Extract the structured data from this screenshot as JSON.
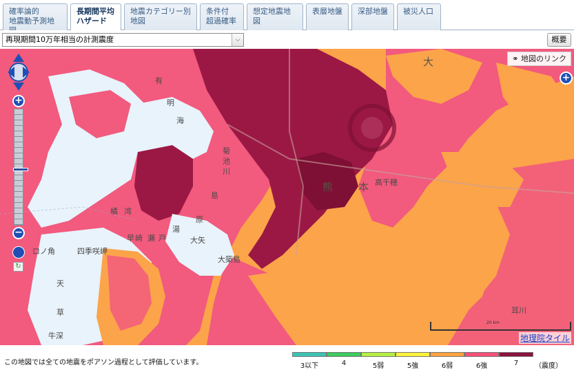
{
  "tabs": [
    {
      "line1": "確率論的",
      "line2": "地震動予測地図",
      "active": false
    },
    {
      "line1": "長期間平均",
      "line2": "ハザード",
      "active": true
    },
    {
      "line1": "地震カテゴリー別",
      "line2": "地図",
      "active": false
    },
    {
      "line1": "条件付",
      "line2": "超過確率",
      "active": false
    },
    {
      "line1": "想定地震地図",
      "line2": "",
      "active": false
    },
    {
      "line1": "表層地盤",
      "line2": "",
      "active": false
    },
    {
      "line1": "深部地盤",
      "line2": "",
      "active": false
    },
    {
      "line1": "被災人口",
      "line2": "",
      "active": false
    }
  ],
  "selector": {
    "value": "再現期間10万年相当の計測震度",
    "arrow": "⌵"
  },
  "overview_button": "概要",
  "map": {
    "link_button": "地図のリンク",
    "tile_credit": "地理院タイル",
    "scale_label": "20 km",
    "labels": [
      {
        "text": "有",
        "big": false
      },
      {
        "text": "明",
        "big": false
      },
      {
        "text": "海",
        "big": false
      },
      {
        "text": "菊",
        "big": false
      },
      {
        "text": "池",
        "big": false
      },
      {
        "text": "川",
        "big": false
      },
      {
        "text": "橘",
        "big": false
      },
      {
        "text": "湾",
        "big": false
      },
      {
        "text": "島",
        "big": false
      },
      {
        "text": "原",
        "big": false
      },
      {
        "text": "早",
        "big": false
      },
      {
        "text": "崎",
        "big": false
      },
      {
        "text": "瀬",
        "big": false
      },
      {
        "text": "戸",
        "big": false
      },
      {
        "text": "湯",
        "big": false
      },
      {
        "text": "大矢",
        "big": false
      },
      {
        "text": "四季咲岬",
        "big": false
      },
      {
        "text": "ロノ角",
        "big": false
      },
      {
        "text": "牛深",
        "big": false
      },
      {
        "text": "天",
        "big": false
      },
      {
        "text": "草",
        "big": false
      },
      {
        "text": "大築島",
        "big": false
      },
      {
        "text": "高千穂",
        "big": false
      },
      {
        "text": "熊",
        "big": true
      },
      {
        "text": "本",
        "big": true
      },
      {
        "text": "大",
        "big": true
      },
      {
        "text": "耳川",
        "big": false
      }
    ]
  },
  "footer": {
    "note": "この地図では全ての地震をポアソン過程として評価しています。",
    "legend": [
      {
        "label": "3以下",
        "color": "#3cc3b3"
      },
      {
        "label": "4",
        "color": "#3ccc5c"
      },
      {
        "label": "5弱",
        "color": "#b6ee44"
      },
      {
        "label": "5強",
        "color": "#fff23a"
      },
      {
        "label": "6弱",
        "color": "#fca23f"
      },
      {
        "label": "6強",
        "color": "#f5507a"
      },
      {
        "label": "7",
        "color": "#8a1240"
      }
    ],
    "unit": "（震度）"
  }
}
